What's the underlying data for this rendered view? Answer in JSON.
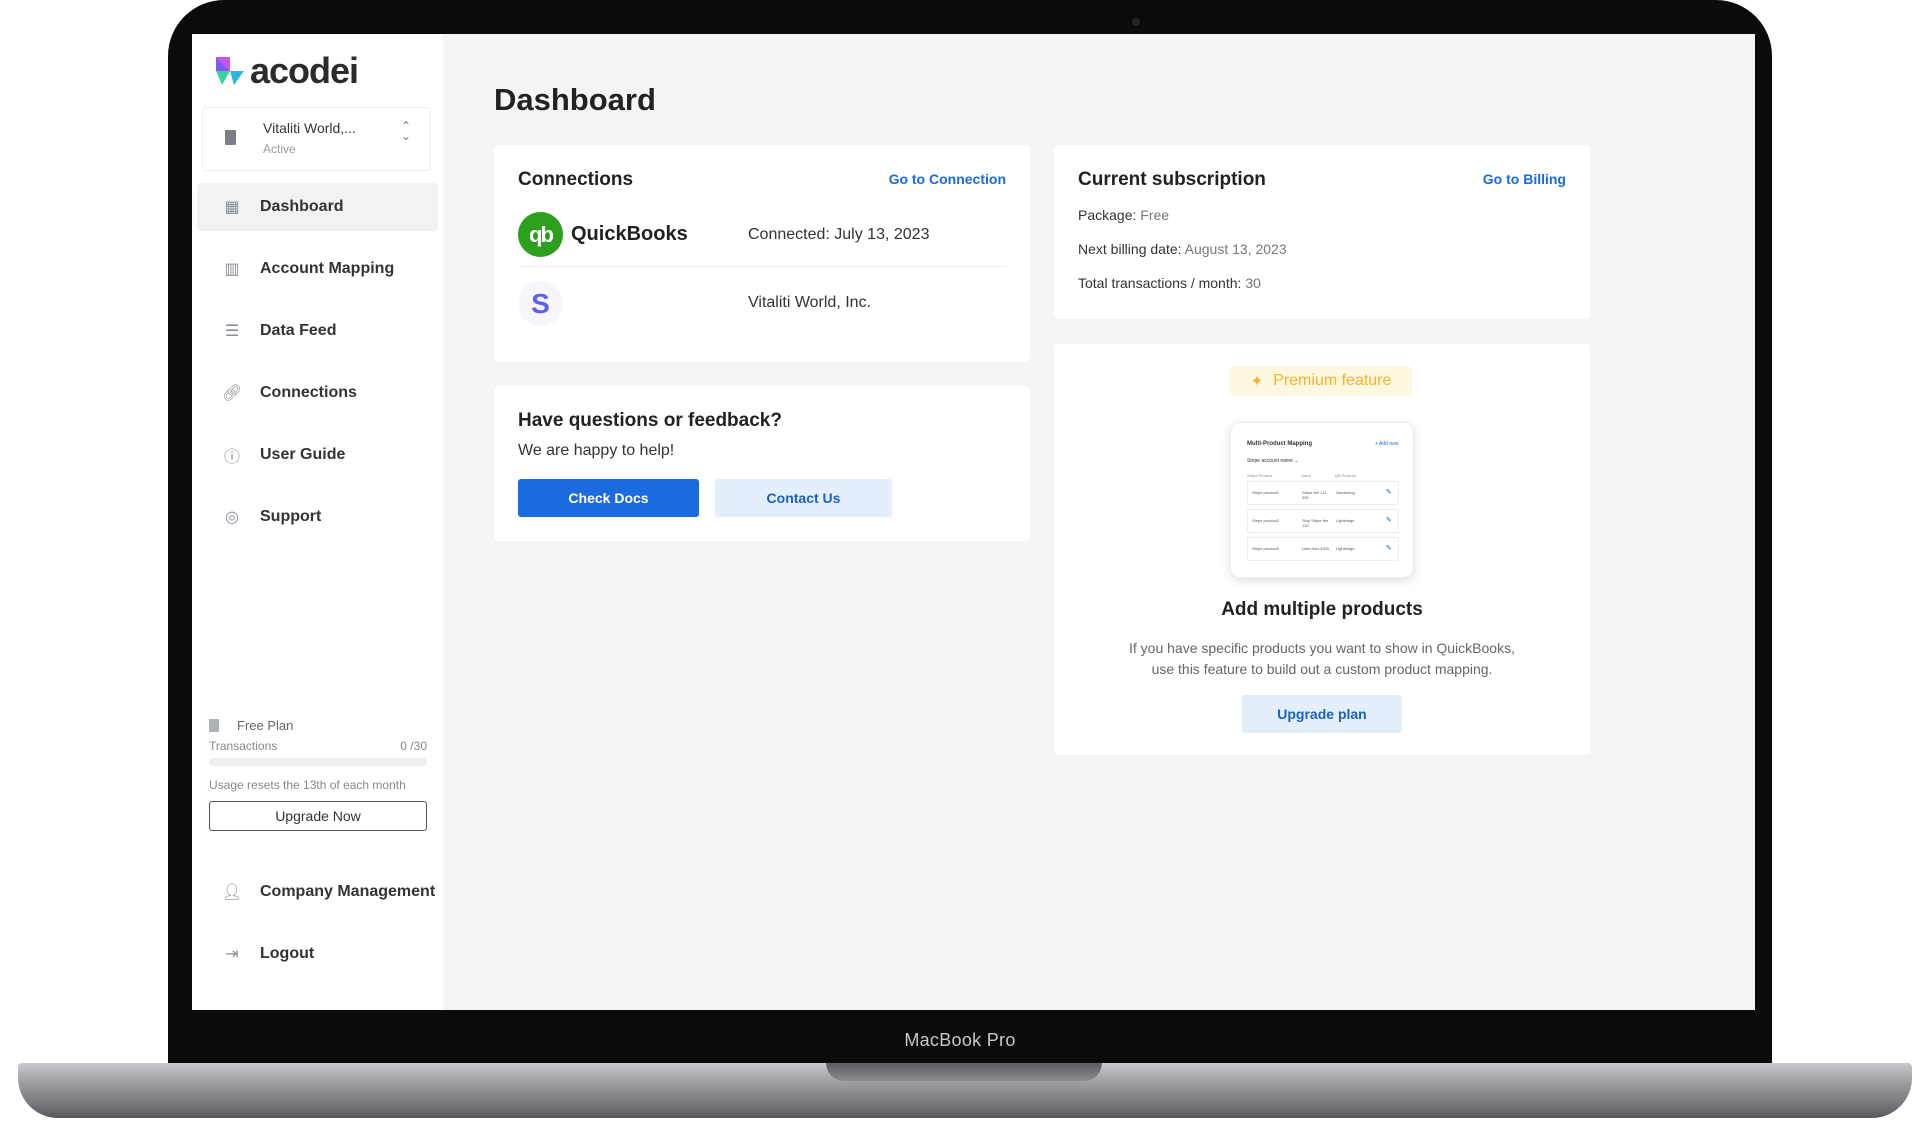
{
  "device": {
    "model": "MacBook Pro"
  },
  "brand": {
    "name": "acodei",
    "accent": "#1a6be0"
  },
  "company": {
    "name": "Vitaliti World,...",
    "status": "Active"
  },
  "nav": {
    "items": [
      {
        "label": "Dashboard",
        "icon": "dashboard-icon",
        "active": true
      },
      {
        "label": "Account Mapping",
        "icon": "map-icon",
        "active": false
      },
      {
        "label": "Data Feed",
        "icon": "list-icon",
        "active": false
      },
      {
        "label": "Connections",
        "icon": "link-icon",
        "active": false
      },
      {
        "label": "User Guide",
        "icon": "info-icon",
        "active": false
      },
      {
        "label": "Support",
        "icon": "lifebuoy-icon",
        "active": false
      }
    ],
    "bottom": [
      {
        "label": "Company Management",
        "icon": "person-icon"
      },
      {
        "label": "Logout",
        "icon": "logout-icon"
      }
    ]
  },
  "plan": {
    "name": "Free Plan",
    "transactions_label": "Transactions",
    "transactions_count": "0 /30",
    "used_fraction": 0,
    "reset_note": "Usage resets the 13th of each month",
    "upgrade_label": "Upgrade Now"
  },
  "page": {
    "title": "Dashboard"
  },
  "connections": {
    "title": "Connections",
    "link": "Go to Connection",
    "rows": [
      {
        "name": "QuickBooks",
        "logo_text": "qb",
        "status": "Connected: July 13, 2023"
      },
      {
        "name": "",
        "logo_text": "S",
        "status": "Vitaliti World, Inc."
      }
    ]
  },
  "feedback": {
    "title": "Have questions or feedback?",
    "subtitle": "We are happy to help!",
    "primary_button": "Check Docs",
    "secondary_button": "Contact Us"
  },
  "subscription": {
    "title": "Current subscription",
    "link": "Go to Billing",
    "package_label": "Package:",
    "package_value": "Free",
    "next_billing_label": "Next billing date:",
    "next_billing_value": "August 13, 2023",
    "transactions_label": "Total transactions / month:",
    "transactions_value": "30"
  },
  "promo": {
    "badge": "Premium feature",
    "preview": {
      "title": "Multi-Product Mapping",
      "add": "+ Add new",
      "select": "Stripe account name ⌄",
      "headers": [
        "Stripe Product",
        "Value",
        "QB Product"
      ],
      "rows": [
        {
          "product": "Stripe product1",
          "value": "Stripe fee 121 000",
          "qb": "Gardening"
        },
        {
          "product": "Stripe product2",
          "value": "Ship Stripe fee 120",
          "qb": "Lightnings"
        },
        {
          "product": "Stripe product3",
          "value": "User fees 4200",
          "qb": "Lightnings"
        }
      ]
    },
    "title": "Add multiple products",
    "text_line1": "If you have specific products you want to show in QuickBooks,",
    "text_line2": "use this feature to build out a custom product mapping.",
    "button": "Upgrade plan"
  }
}
